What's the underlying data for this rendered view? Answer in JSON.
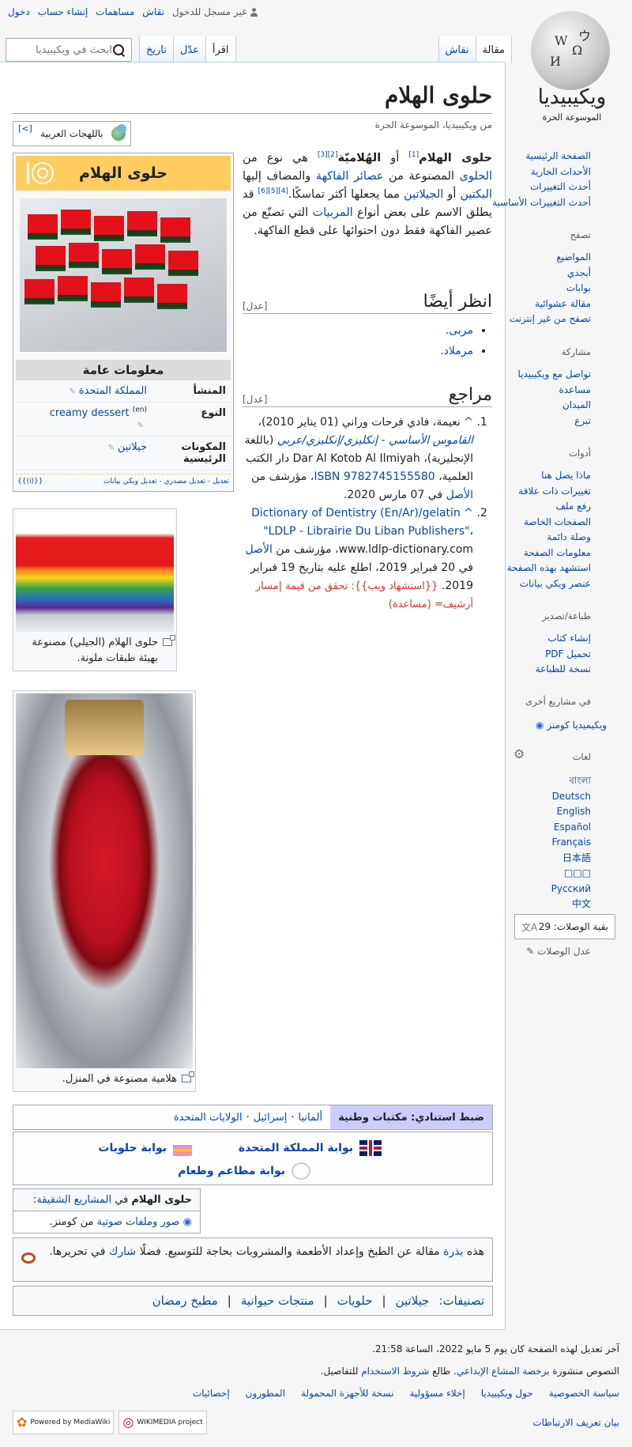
{
  "user": {
    "not_logged": "غير مسجل للدخول",
    "talk": "نقاش",
    "contributions": "مساهمات",
    "create_account": "إنشاء حساب",
    "login": "دخول"
  },
  "search": {
    "placeholder": "ابحث في ويكيبيديا"
  },
  "tabs_left": [
    "مقالة",
    "نقاش"
  ],
  "tabs_right": [
    "اقرأ",
    "عدّل",
    "تاريخ"
  ],
  "logo": {
    "title": "ويكيبيديا",
    "subtitle": "الموسوعة الحرة"
  },
  "nav": {
    "main": [
      "الصفحة الرئيسية",
      "الأحداث الجارية",
      "أحدث التغييرات",
      "أحدث التغييرات الأساسية"
    ],
    "browse_h": "تصفح",
    "browse": [
      "المواضيع",
      "أبجدي",
      "بوابات",
      "مقالة عشوائية",
      "تصفح من غير إنترنت"
    ],
    "participate_h": "مشاركة",
    "participate": [
      "تواصل مع ويكيبيديا",
      "مساعدة",
      "الميدان",
      "تبرع"
    ],
    "tools_h": "أدوات",
    "tools": [
      "ماذا يصل هنا",
      "تغييرات ذات علاقة",
      "رفع ملف",
      "الصفحات الخاصة",
      "وصلة دائمة",
      "معلومات الصفحة",
      "استشهد بهذه الصفحة",
      "عنصر ويكي بيانات"
    ],
    "print_h": "طباعة/تصدير",
    "print": [
      "إنشاء كتاب",
      "تحميل PDF",
      "نسخة للطباعة"
    ],
    "projects_h": "في مشاريع أخرى",
    "projects": [
      "ويكيميديا كومنز"
    ],
    "langs_h": "لغات",
    "langs": [
      "বাংলা",
      "Deutsch",
      "English",
      "Español",
      "Français",
      "日本語",
      "□□□",
      "Русский",
      "中文"
    ],
    "langsearch": "بقية الوصلات: 29",
    "editlinks": "عدل الوصلات"
  },
  "article": {
    "title": "حلوى الهلام",
    "tagline": "من ويكيبيديا، الموسوعة الحرة",
    "dialects": "باللهجات العربية",
    "lead": {
      "t1": "حلوى الهلام",
      "s1": "[1]",
      "t2": " أو ",
      "t3": "الهُلاميّة",
      "s2": "[2]",
      "s3": "[3]",
      "t4": " هي نوع من ",
      "l1": "الحلوى",
      "t5": " المصنوعة من ",
      "l2": "عصائر الفاكهة",
      "t6": " والمضاف إليها ",
      "l3": "البكتين",
      "t7": " أو ",
      "l4": "الجيلاتين",
      "t8": " مما يجعلها أكثر تماسكًا.",
      "s4": "[4]",
      "s5": "[5]",
      "s6": "[6]",
      "t9": " قد يطلق الاسم على بعض أنواع ",
      "l5": "المربيات",
      "t10": " التي تصنّع من عصير الفاكهة فقط دون احتوائها على قطع الفاكهة."
    },
    "see_also_h": "انظر أيضًا",
    "edit": "[عدل]",
    "see_also": [
      "مربى.",
      "مرملاد."
    ],
    "refs_h": "مراجع",
    "ref1": {
      "a": "^",
      "p1": "نعيمة، فادي فرحات وراني (01 يناير 2010)، ",
      "l1": "القاموس الأساسي - إنكليزي/إنكليزي/عربي",
      "p2": " (باللغة الإنجليزية)، Dar Al Kotob Al Ilmiyah دار الكتب العلمية، ",
      "l2": "ISBN 9782745155580",
      "p3": "، مؤرشف من ",
      "l3": "الأصل",
      "p4": " في 07 مارس 2020."
    },
    "ref2": {
      "a": "^",
      "l1": "Dictionary of Dentistry (En/Ar)/gelatin \"LDLP - Librairie Du Liban Publishers\"",
      "p1": "، www.ldlp-dictionary.com، مؤرشف من ",
      "l2": "الأصل",
      "p2": " في 20 فبراير 2019، اطلع عليه بتاريخ 19 فبراير 2019.",
      "err": "{{استشهاد ويب}}: تحقق من قيمة |مسار أرشيف= (مساعدة)"
    }
  },
  "infobox": {
    "title": "حلوى الهلام",
    "general": "معلومات عامة",
    "rows": [
      {
        "k": "المنشأ",
        "v": "المملكة المتحدة"
      },
      {
        "k": "النوع",
        "v": "creamy dessert",
        "sup": "(en)"
      },
      {
        "k": "المكونات الرئيسية",
        "v": "جيلاتين"
      }
    ],
    "foot": "تعديل - تعديل مصدري - تعديل ويكي بيانات"
  },
  "captions": [
    "حلوى الهلام (الجيلي) مصنوعة بهيئة طبقات ملونة.",
    "هلامية مصنوعة في المنزل."
  ],
  "authority": {
    "h": "ضبط استنادي: مكتبات وطنية",
    "items": [
      "ألمانيا",
      "إسرائيل",
      "الولايات المتحدة"
    ]
  },
  "portals": [
    "بوابة المملكة المتحدة",
    "بوابة حلويات",
    "بوابة مطاعم وطعام"
  ],
  "sister": {
    "t1": "حلوى الهلام",
    "t2": " في ",
    "l": "المشاريع الشقيقة",
    "t3": ":",
    "b1": "صور وملفات صوتية",
    "b2": " من كومنز."
  },
  "stub": {
    "a": "هذه ",
    "l1": "بذرة",
    "b": " مقالة عن الطبخ وإعداد الأطعمة والمشروبات بحاجة للتوسيع. فضلًا ",
    "l2": "شارك",
    "c": " في تحريرها."
  },
  "cats": {
    "label": "تصنيفات",
    "items": [
      "جيلاتين",
      "حلويات",
      "منتجات حيوانية",
      "مطبخ رمضان"
    ]
  },
  "footer": {
    "modified": "آخر تعديل لهذه الصفحة كان يوم 5 مايو 2022، الساعة 21:58.",
    "license_a": "النصوص منشورة ",
    "license_l": "برخصة المشاع الإبداعي",
    "license_b": ". طالع ",
    "license_l2": "شروط الاستخدام",
    "license_c": " للتفاصيل.",
    "links": [
      "سياسة الخصوصية",
      "حول ويكيبيديا",
      "إخلاء مسؤولية",
      "نسخة للأجهزة المحمولة",
      "المطورون",
      "إحصائيات"
    ],
    "cookie": "بيان تعريف الارتباطات",
    "wm": "WIKIMEDIA project",
    "mw": "Powered by MediaWiki"
  }
}
